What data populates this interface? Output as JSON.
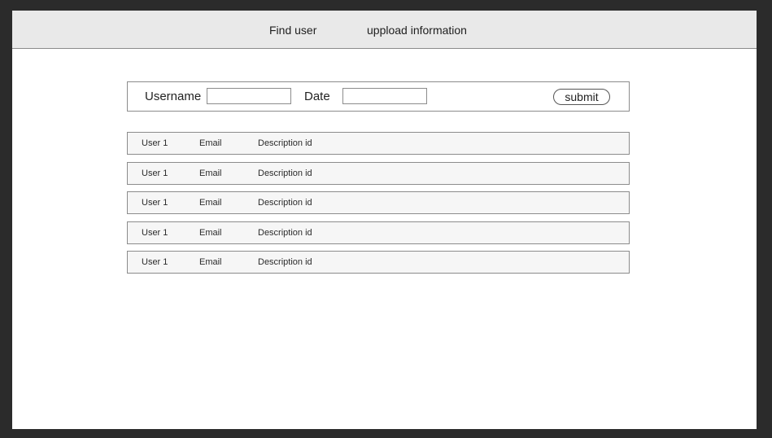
{
  "nav": {
    "items": [
      {
        "label": "Find user"
      },
      {
        "label": "uppload information"
      }
    ]
  },
  "search": {
    "username_label": "Username",
    "username_value": "",
    "date_label": "Date",
    "date_value": "",
    "submit_label": "submit"
  },
  "results": {
    "rows": [
      {
        "user": "User 1",
        "email": "Email",
        "description": "Description id"
      },
      {
        "user": "User 1",
        "email": "Email",
        "description": "Description id"
      },
      {
        "user": "User 1",
        "email": "Email",
        "description": "Description id"
      },
      {
        "user": "User 1",
        "email": "Email",
        "description": "Description id"
      },
      {
        "user": "User 1",
        "email": "Email",
        "description": "Description id"
      }
    ]
  }
}
